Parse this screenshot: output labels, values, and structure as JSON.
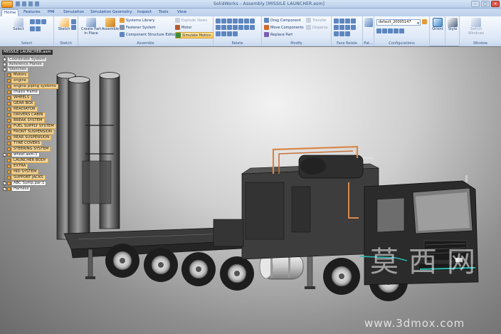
{
  "window": {
    "title": "SolidWorks - Assembly [MISSILE LAUNCHER.asm]"
  },
  "tabs": [
    {
      "label": "Home",
      "active": true
    },
    {
      "label": "Features"
    },
    {
      "label": "PMI"
    },
    {
      "label": "Simulation"
    },
    {
      "label": "Simulation Geometry"
    },
    {
      "label": "Inspect"
    },
    {
      "label": "Tools"
    },
    {
      "label": "View"
    }
  ],
  "ribbon": {
    "select": {
      "label": "Select",
      "button": "Select"
    },
    "sketch": {
      "label": "Sketch",
      "button": "Sketch"
    },
    "assemble": {
      "label": "Assemble",
      "create_part": "Create Part In Place",
      "assemble": "Assemble",
      "systems_library": "Systems Library",
      "fastener_system": "Fastener System",
      "component_structure_editor": "Component Structure Editor",
      "explode_views": "Explode Views",
      "motor": "Motor",
      "simulate_motion": "Simulate Motion"
    },
    "relate": {
      "label": "Relate"
    },
    "modify": {
      "label": "Modify",
      "drag_component": "Drag Component",
      "move_components": "Move Components",
      "replace_part": "Replace Part",
      "transfer": "Transfer",
      "disperse": "Disperse"
    },
    "face_relate": {
      "label": "Face Relate"
    },
    "pattern": {
      "label": "Pat..."
    },
    "configurations": {
      "label": "Configurations",
      "selected": "default_20005147"
    },
    "orient": {
      "label": "Orient"
    },
    "style": {
      "label": "Style"
    },
    "window_group": {
      "label": "Window",
      "switch_windows": "Switch Windows"
    }
  },
  "tree": {
    "root": "MISSILE LAUNCHER.asm",
    "items": [
      {
        "label": "Coordinate System",
        "kind": "sys"
      },
      {
        "label": "Reference Planes",
        "kind": "sys"
      },
      {
        "label": "Sketches",
        "kind": "sys"
      },
      {
        "label": "Motors",
        "kind": "folder"
      },
      {
        "label": "engine",
        "kind": "folder"
      },
      {
        "label": "engine piping systems",
        "kind": "folder"
      },
      {
        "label": "chasis frame",
        "kind": "white"
      },
      {
        "label": "WHEELS",
        "kind": "folder"
      },
      {
        "label": "GEAR BOX",
        "kind": "folder"
      },
      {
        "label": "READIATOR",
        "kind": "folder"
      },
      {
        "label": "DRIVERS CABIN",
        "kind": "folder"
      },
      {
        "label": "BREAK SYSTEM",
        "kind": "folder"
      },
      {
        "label": "FUEL SUPPLY SYSTEM",
        "kind": "folder"
      },
      {
        "label": "FRONT SUSPENSION",
        "kind": "folder"
      },
      {
        "label": "REAR SUSPENSION",
        "kind": "folder"
      },
      {
        "label": "TYRE COVERS",
        "kind": "folder"
      },
      {
        "label": "STEERING SYSTEM",
        "kind": "folder"
      },
      {
        "label": "wheel.asm:1",
        "kind": "white"
      },
      {
        "label": "LAUNCHER BODY",
        "kind": "folder"
      },
      {
        "label": "EXTRA",
        "kind": "folder"
      },
      {
        "label": "HID SYSTEM",
        "kind": "folder"
      },
      {
        "label": "SUPPORT JACKS",
        "kind": "folder"
      },
      {
        "label": "ABC Sump.par:1",
        "kind": "white"
      },
      {
        "label": "Harness",
        "kind": "white"
      }
    ]
  },
  "watermark": {
    "chinese": "莫西网",
    "url": "www.3dmox.com"
  },
  "colors": {
    "ribbon_text": "#1e3a66",
    "highlight": "#ffc95c",
    "tree_folder": "#f4d59a",
    "truck_body": "#2b2b2b",
    "piping": "#d9884a"
  }
}
